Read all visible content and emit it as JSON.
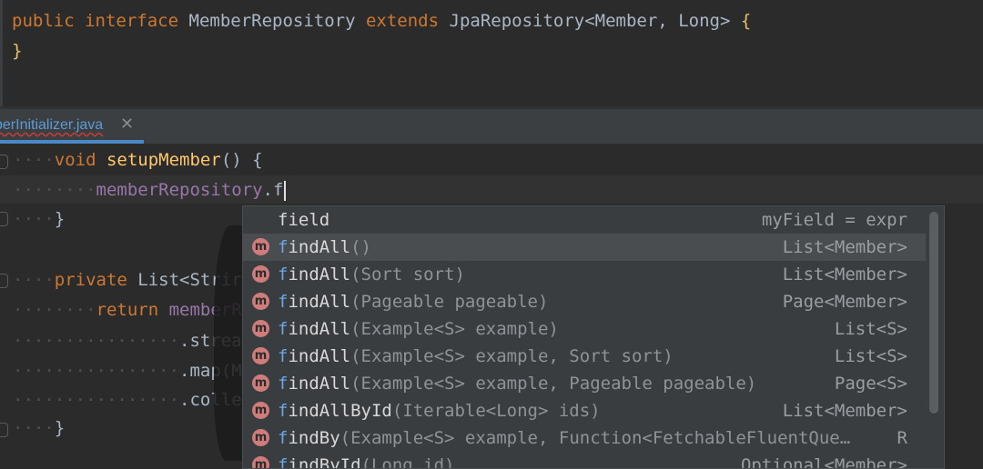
{
  "top_code": {
    "line1": {
      "kw1": "public",
      "kw2": "interface",
      "name": "MemberRepository",
      "kw3": "extends",
      "base": "JpaRepository",
      "generic": "<Member,",
      "generic2": "Long>",
      "brace": "{"
    },
    "line2": {
      "brace": "}"
    }
  },
  "tab": {
    "label": "berInitializer.java",
    "close": "✕"
  },
  "editor": {
    "line1": {
      "kw": "void",
      "fn": "setupMember",
      "rest": "() {"
    },
    "line2": {
      "field": "memberRepository",
      "dot": ".f"
    },
    "line3": {
      "brace": "}"
    },
    "line4": {
      "kw": "private",
      "rest": "List<Strir"
    },
    "line5": {
      "kw": "return",
      "rest": "memberR"
    },
    "line6": {
      "text": ".strea"
    },
    "line7": {
      "text": ".map(M"
    },
    "line8": {
      "text": ".colle"
    },
    "line9": {
      "brace": "}"
    }
  },
  "completion": {
    "items": [
      {
        "icon": "",
        "hl": "",
        "name": "field",
        "params": "",
        "type": "myField = expr"
      },
      {
        "icon": "m",
        "hl": "f",
        "name": "indAll",
        "params": "()",
        "type": "List<Member>"
      },
      {
        "icon": "m",
        "hl": "f",
        "name": "indAll",
        "params": "(Sort sort)",
        "type": "List<Member>"
      },
      {
        "icon": "m",
        "hl": "f",
        "name": "indAll",
        "params": "(Pageable pageable)",
        "type": "Page<Member>"
      },
      {
        "icon": "m",
        "hl": "f",
        "name": "indAll",
        "params": "(Example<S> example)",
        "type": "List<S>"
      },
      {
        "icon": "m",
        "hl": "f",
        "name": "indAll",
        "params": "(Example<S> example, Sort sort)",
        "type": "List<S>"
      },
      {
        "icon": "m",
        "hl": "f",
        "name": "indAll",
        "params": "(Example<S> example, Pageable pageable)",
        "type": "Page<S>"
      },
      {
        "icon": "m",
        "hl": "f",
        "name": "indAllById",
        "params": "(Iterable<Long> ids)",
        "type": "List<Member>"
      },
      {
        "icon": "m",
        "hl": "f",
        "name": "indBy",
        "params": "(Example<S> example, Function<FetchableFluentQue…",
        "type": "R"
      },
      {
        "icon": "m",
        "hl": "f",
        "name": "indById",
        "params": "(Long id)",
        "type": "Optional<Member>"
      }
    ]
  },
  "colors": {
    "accent": "#4a88c7",
    "keyword": "#cc7832",
    "method": "#ffc66d",
    "field": "#9876aa",
    "match": "#6aa7e8"
  }
}
